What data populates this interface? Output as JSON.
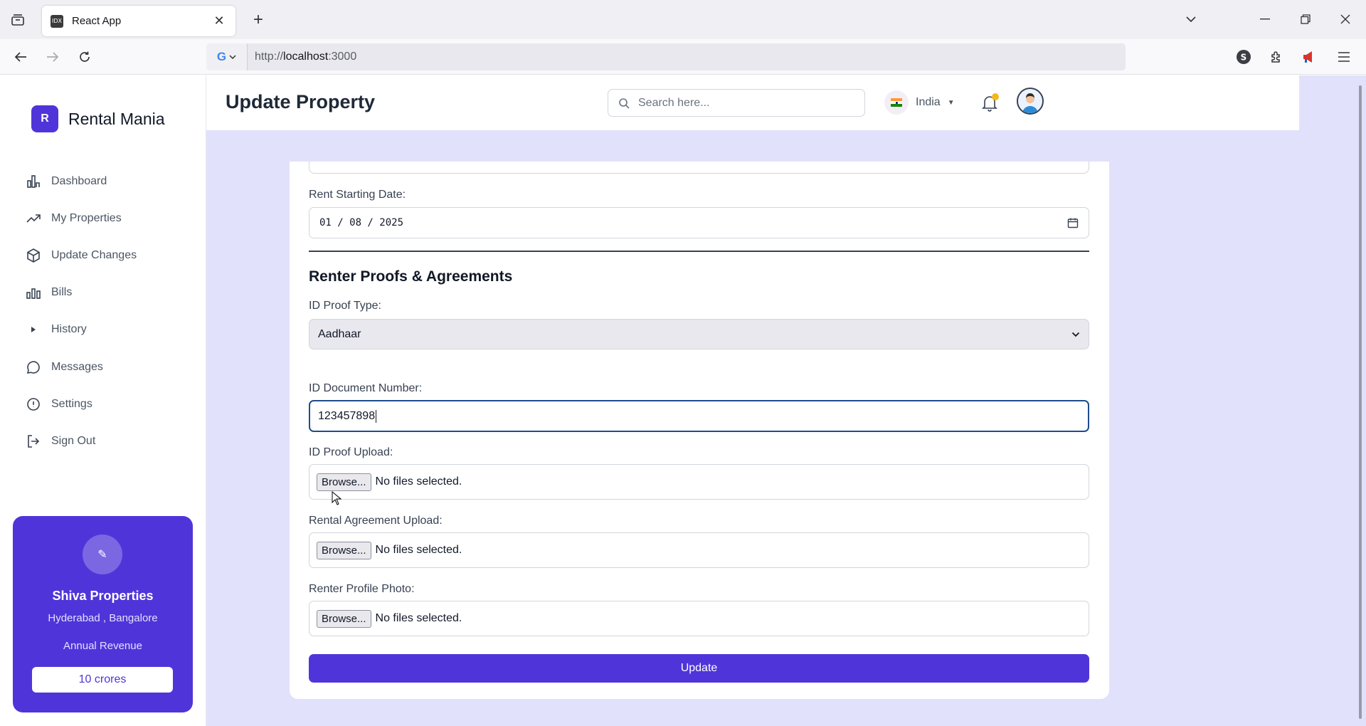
{
  "browser": {
    "tab_title": "React App",
    "tab_favicon_text": "IDX",
    "url_prefix": "http://",
    "url_host": "localhost",
    "url_suffix": ":3000",
    "search_engine_logo": "G"
  },
  "brand": {
    "logo_letter": "R",
    "name": "Rental Mania"
  },
  "sidebar": {
    "items": [
      {
        "label": "Dashboard",
        "icon": "bar-chart-icon"
      },
      {
        "label": "My Properties",
        "icon": "trending-up-icon"
      },
      {
        "label": "Update Changes",
        "icon": "box-icon"
      },
      {
        "label": "Bills",
        "icon": "bills-chart-icon"
      },
      {
        "label": "History",
        "icon": "arrow-right-icon"
      },
      {
        "label": "Messages",
        "icon": "message-circle-icon"
      },
      {
        "label": "Settings",
        "icon": "info-circle-icon"
      },
      {
        "label": "Sign Out",
        "icon": "log-out-icon"
      }
    ],
    "profile_card": {
      "name": "Shiva Properties",
      "locations": "Hyderabad , Bangalore",
      "revenue_label": "Annual Revenue",
      "revenue_value": "10 crores",
      "accent": "#4f35d9"
    }
  },
  "header": {
    "title": "Update Property",
    "search_placeholder": "Search here...",
    "language": "India",
    "notification_dot_color": "#f5b81c"
  },
  "form": {
    "rent_start_label": "Rent Starting Date:",
    "rent_start_value": "01 / 08 / 2025",
    "section_title": "Renter Proofs & Agreements",
    "id_proof_type_label": "ID Proof Type:",
    "id_proof_type_value": "Aadhaar",
    "id_doc_number_label": "ID Document Number:",
    "id_doc_number_value": "123457898",
    "id_proof_upload_label": "ID Proof Upload:",
    "rental_agreement_label": "Rental Agreement Upload:",
    "renter_photo_label": "Renter Profile Photo:",
    "browse_label": "Browse...",
    "no_file_text": "No files selected.",
    "submit_label": "Update"
  }
}
